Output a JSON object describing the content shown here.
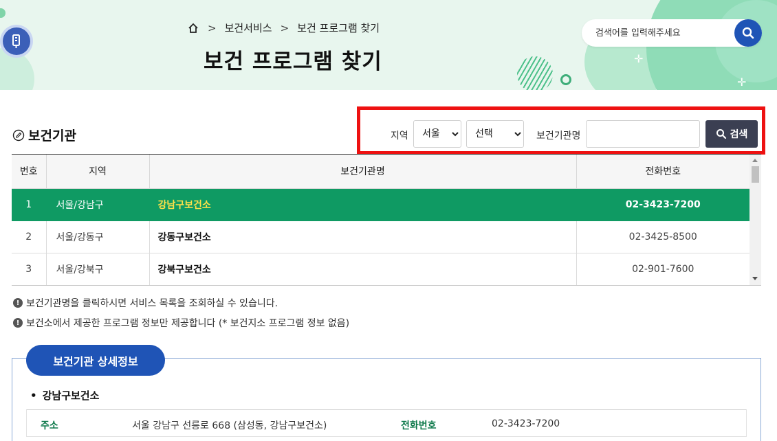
{
  "header": {
    "breadcrumb": [
      "보건서비스",
      "보건 프로그램 찾기"
    ],
    "page_title": "보건 프로그램 찾기",
    "search_placeholder": "검색어를 입력해주세요"
  },
  "section": {
    "title": "보건기관"
  },
  "filter": {
    "region_label": "지역",
    "region_value": "서울",
    "district_value": "선택",
    "name_label": "보건기관명",
    "name_value": "",
    "search_button": "검색"
  },
  "table": {
    "headers": [
      "번호",
      "지역",
      "보건기관명",
      "전화번호"
    ],
    "rows": [
      {
        "no": "1",
        "area": "서울/강남구",
        "name": "강남구보건소",
        "tel": "02-3423-7200",
        "selected": true
      },
      {
        "no": "2",
        "area": "서울/강동구",
        "name": "강동구보건소",
        "tel": "02-3425-8500",
        "selected": false
      },
      {
        "no": "3",
        "area": "서울/강북구",
        "name": "강북구보건소",
        "tel": "02-901-7600",
        "selected": false
      }
    ]
  },
  "notes": [
    "보건기관명을 클릭하시면 서비스 목록을 조회하실 수 있습니다.",
    "보건소에서 제공한 프로그램 정보만 제공합니다 (* 보건지소 프로그램 정보 없음)"
  ],
  "detail": {
    "tab_label": "보건기관 상세정보",
    "name": "강남구보건소",
    "address_label": "주소",
    "address_value": "서울 강남구 선릉로 668 (삼성동, 강남구보건소)",
    "tel_label": "전화번호",
    "tel_value": "02-3423-7200"
  },
  "colors": {
    "selected_row": "#0f9a63",
    "selected_name": "#ffe24a",
    "primary_blue": "#1f54b6",
    "search_button": "#3b3f52",
    "highlight_border": "#ee1111"
  },
  "icons": [
    "home-icon",
    "search-icon",
    "pen-icon",
    "info-icon",
    "logo-icon"
  ]
}
